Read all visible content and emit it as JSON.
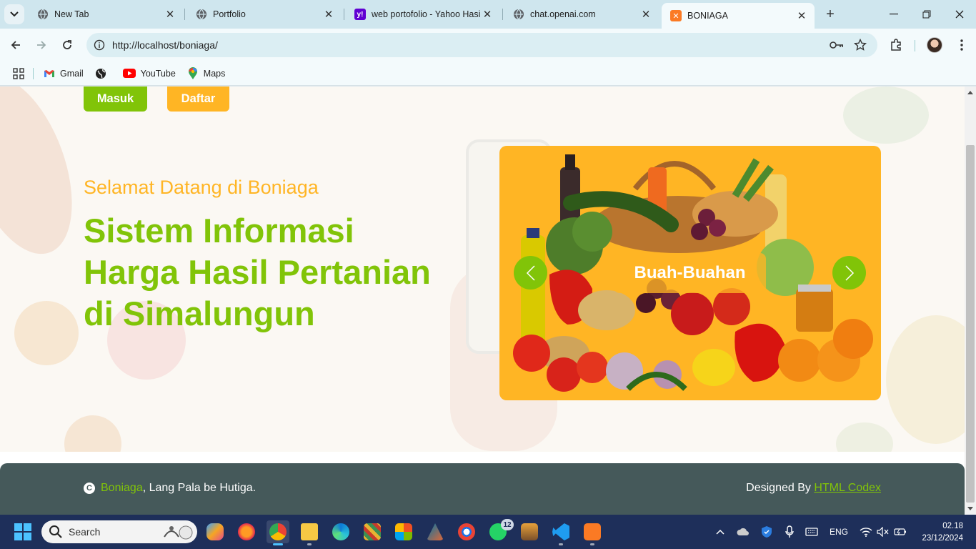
{
  "browser": {
    "tabs": [
      {
        "title": "New Tab",
        "favicon": "globe-icon"
      },
      {
        "title": "Portfolio",
        "favicon": "globe-icon"
      },
      {
        "title": "web portofolio - Yahoo Hasil",
        "favicon": "yahoo-icon"
      },
      {
        "title": "chat.openai.com",
        "favicon": "globe-icon"
      },
      {
        "title": "BONIAGA",
        "favicon": "xampp-icon",
        "active": true
      }
    ],
    "url": "http://localhost/boniaga/",
    "bookmarks": [
      {
        "label": "Gmail",
        "icon": "gmail-icon"
      },
      {
        "label": "",
        "icon": "globe-icon"
      },
      {
        "label": "YouTube",
        "icon": "youtube-icon"
      },
      {
        "label": "Maps",
        "icon": "maps-icon"
      }
    ]
  },
  "page": {
    "buttons": {
      "login": "Masuk",
      "register": "Daftar"
    },
    "hero": {
      "welcome": "Selamat Datang di Boniaga",
      "headline_line1": "Sistem Informasi",
      "headline_line2": "Harga Hasil Pertanian",
      "headline_line3": "di Simalungun"
    },
    "carousel": {
      "caption": "Buah-Buahan"
    },
    "footer": {
      "brand": "Boniaga",
      "address": ", Lang Pala be Hutiga.",
      "designed_prefix": "Designed By ",
      "designed_link": "HTML Codex"
    }
  },
  "taskbar": {
    "search_placeholder": "Search",
    "whatsapp_badge": "12",
    "language": "ENG",
    "time": "02.18",
    "date": "23/12/2024"
  },
  "colors": {
    "accent_green": "#81c408",
    "accent_orange": "#ffb524",
    "footer_bg": "#45595a",
    "tab_strip": "#cfe6ee",
    "taskbar_bg": "#1e2f5a"
  }
}
